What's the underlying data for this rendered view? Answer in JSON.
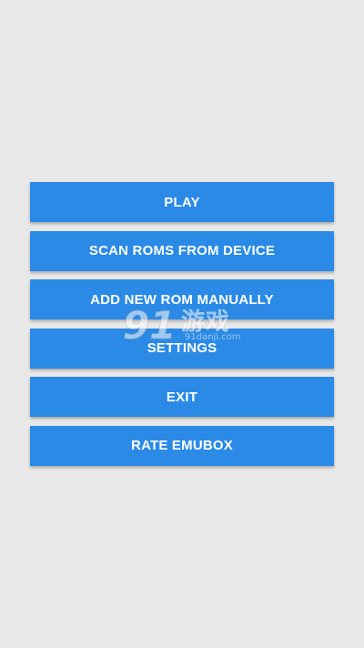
{
  "menu": {
    "buttons": [
      {
        "label": "PLAY"
      },
      {
        "label": "SCAN ROMS FROM DEVICE"
      },
      {
        "label": "ADD NEW ROM MANUALLY"
      },
      {
        "label": "SETTINGS"
      },
      {
        "label": "EXIT"
      },
      {
        "label": "RATE EMUBOX"
      }
    ]
  },
  "watermark": {
    "logo_text": "91",
    "title": "游戏",
    "url": "91danji.com"
  },
  "colors": {
    "background": "#e8e8e8",
    "button": "#2a8ae6",
    "button_text": "#ffffff"
  }
}
